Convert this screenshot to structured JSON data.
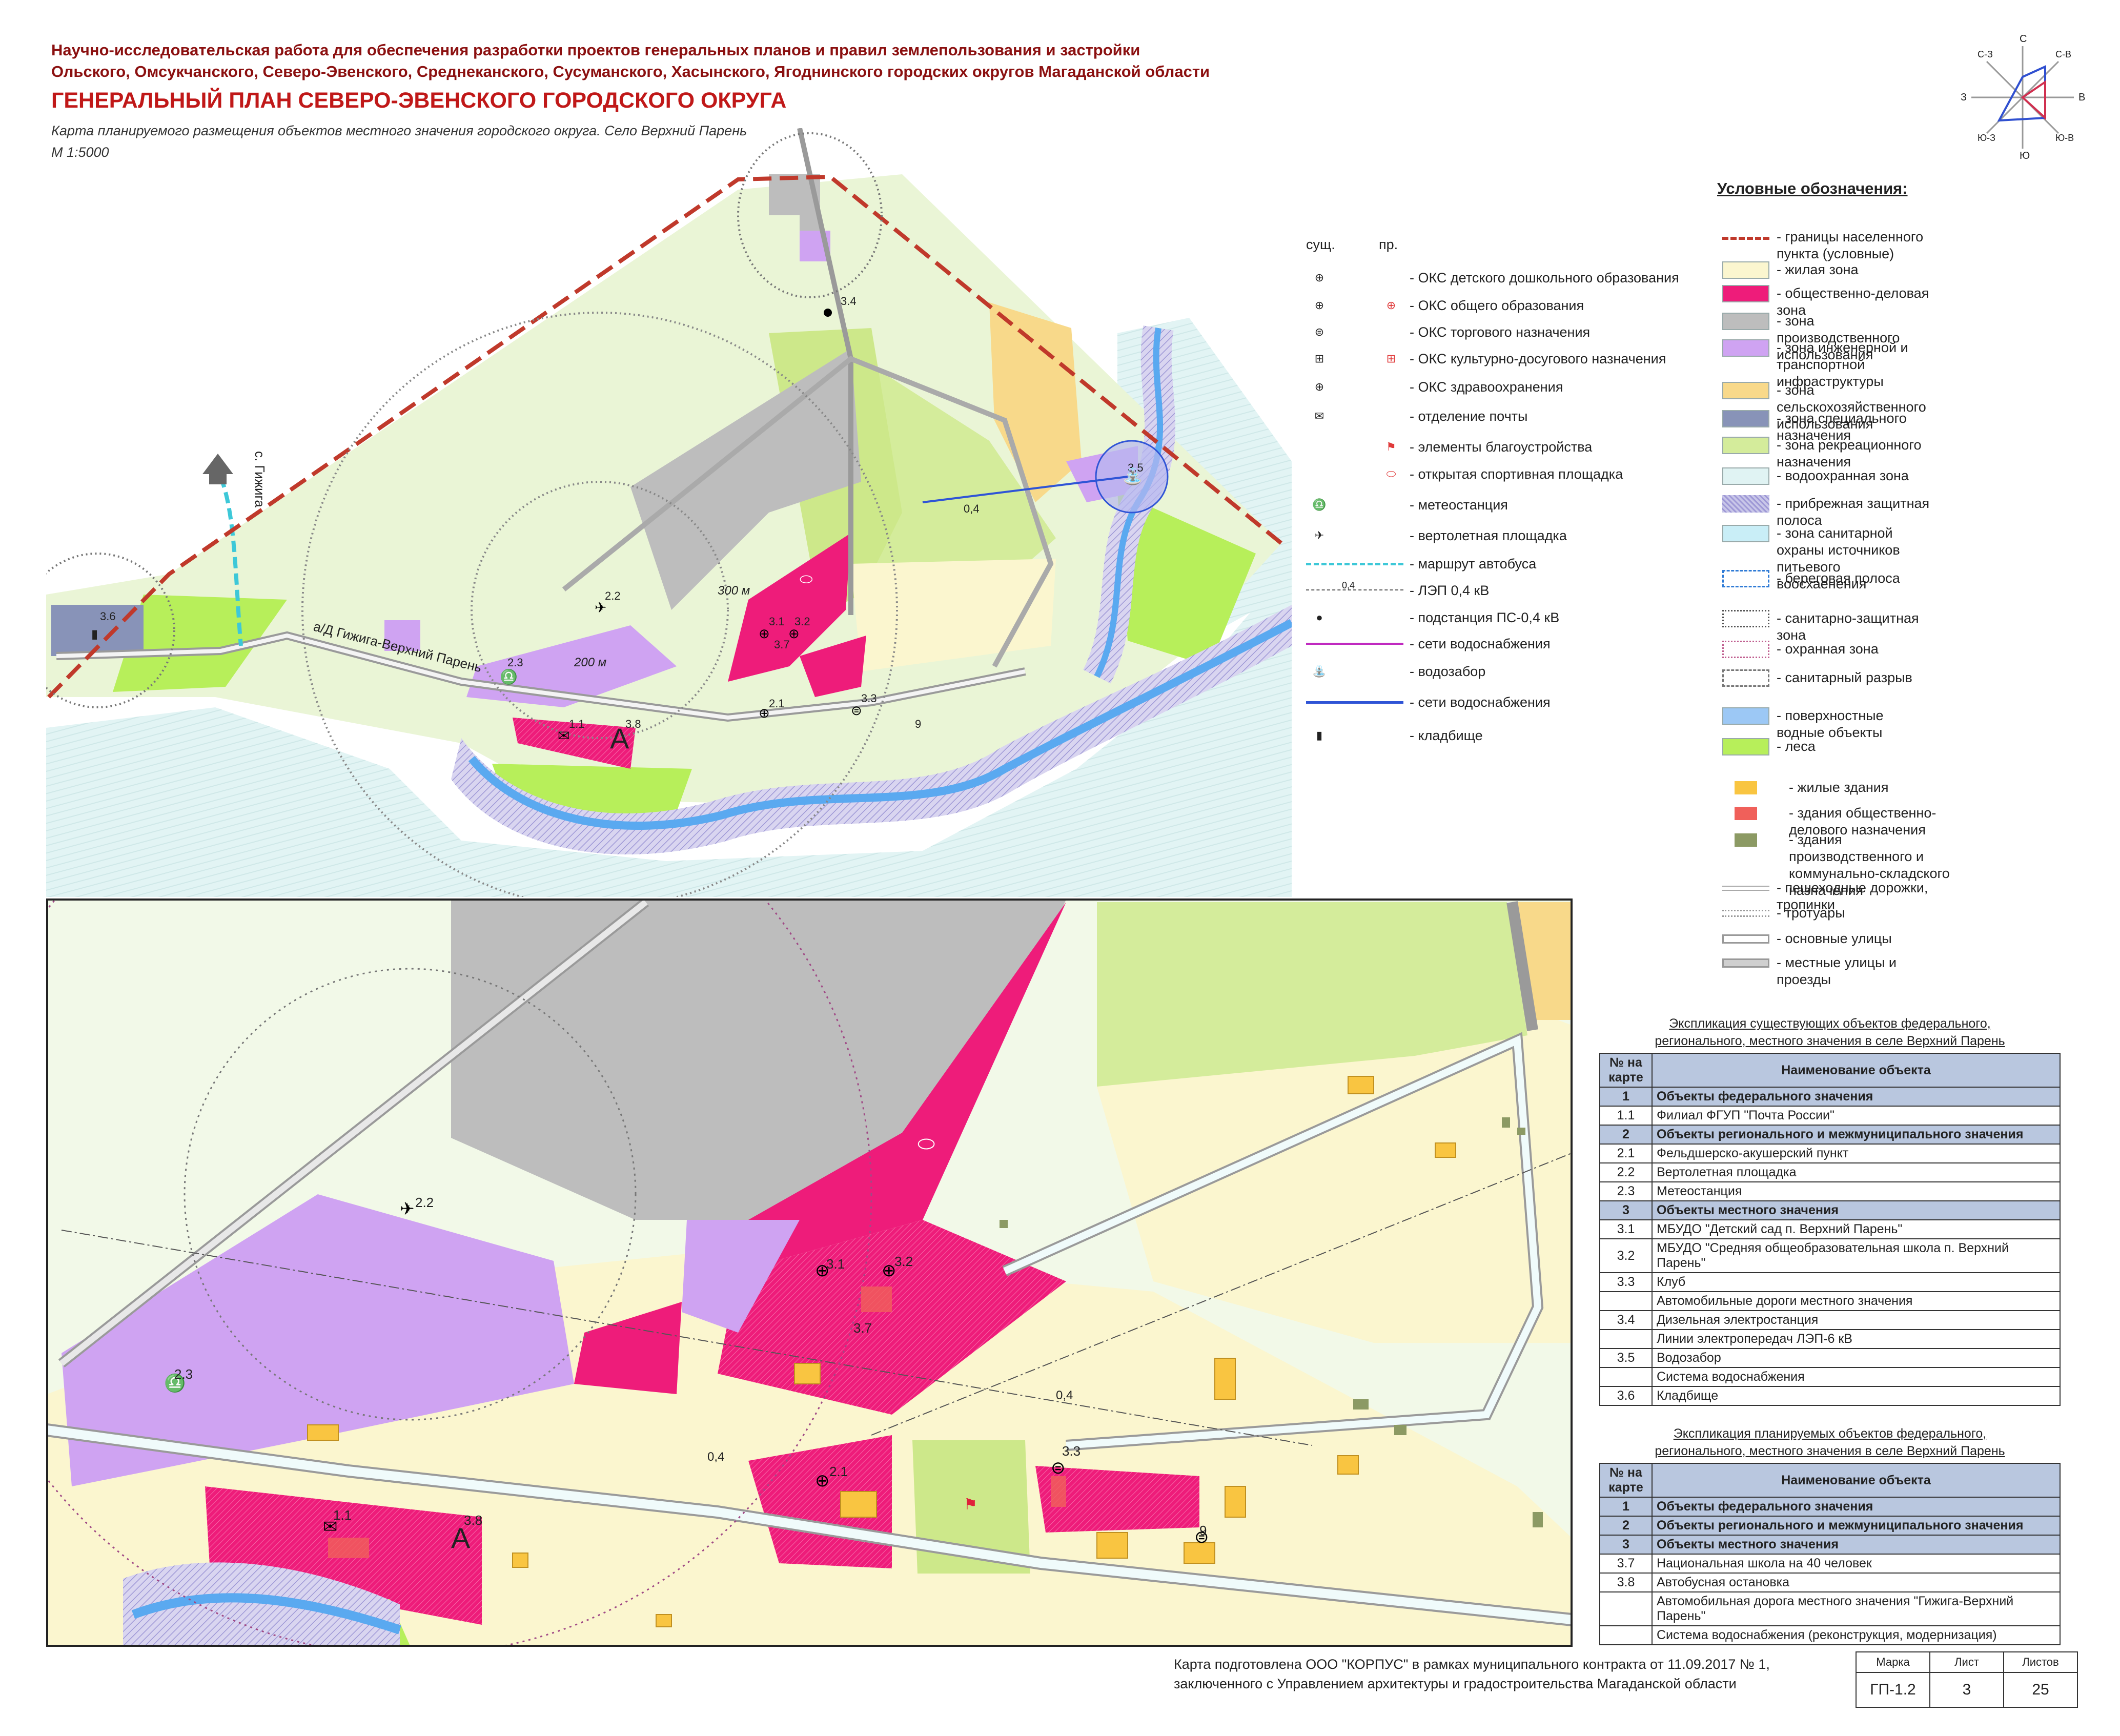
{
  "header": {
    "line1": "Научно-исследовательская работа для обеспечения разработки проектов генеральных планов и правил землепользования и застройки",
    "line2": "Ольского, Омсукчанского, Северо-Эвенского, Среднеканского, Сусуманского, Хасынского, Ягоднинского городских округов Магаданской области",
    "title": "ГЕНЕРАЛЬНЫЙ ПЛАН СЕВЕРО-ЭВЕНСКОГО ГОРОДСКОГО ОКРУГА",
    "subtitle": "Карта планируемого размещения объектов местного значения городского округа. Село Верхний Парень",
    "scale": "М 1:5000"
  },
  "compass": {
    "n": "С",
    "s": "Ю",
    "e": "В",
    "w": "З",
    "nw": "С-З",
    "ne": "С-В",
    "sw": "Ю-З",
    "se": "Ю-В"
  },
  "map_labels": {
    "village": "с. Гижига",
    "road": "а/Д Гижига-Верхний Парень",
    "dist300": "300 м",
    "dist200": "200 м",
    "line04": "0,4",
    "marker_a": "А",
    "obj": [
      "1.1",
      "2.1",
      "2.2",
      "2.3",
      "3.1",
      "3.2",
      "3.3",
      "3.4",
      "3.5",
      "3.6",
      "3.7",
      "3.8",
      "9"
    ]
  },
  "objects_legend": {
    "col_existing": "сущ.",
    "col_planned": "пр.",
    "items": [
      {
        "label": "- ОКС детского дошкольного образования",
        "icon": "kindergarten-icon",
        "existing": true,
        "planned": false
      },
      {
        "label": "- ОКС общего образования",
        "icon": "school-icon",
        "existing": true,
        "planned": true
      },
      {
        "label": "- ОКС торгового назначения",
        "icon": "shop-icon",
        "existing": true,
        "planned": false
      },
      {
        "label": "- ОКС культурно-досугового назначения",
        "icon": "culture-icon",
        "existing": true,
        "planned": true
      },
      {
        "label": "- ОКС здравоохранения",
        "icon": "health-icon",
        "existing": true,
        "planned": false
      },
      {
        "label": "- отделение почты",
        "icon": "post-icon",
        "existing": true,
        "planned": false
      },
      {
        "label": "- элементы благоустройства",
        "icon": "landscaping-icon",
        "existing": false,
        "planned": true
      },
      {
        "label": "- открытая спортивная площадка",
        "icon": "sports-ground-icon",
        "existing": false,
        "planned": true
      },
      {
        "label": "- метеостанция",
        "icon": "weather-station-icon",
        "existing": true,
        "planned": false
      },
      {
        "label": "- вертолетная площадка",
        "icon": "helipad-icon",
        "existing": true,
        "planned": false
      },
      {
        "label": "- маршрут автобуса",
        "icon": "bus-route-icon",
        "existing": false,
        "planned": true
      },
      {
        "label": "- ЛЭП 0,4 кВ",
        "icon": "power-line-icon",
        "existing": true,
        "planned": false
      },
      {
        "label": "- подстанция ПС-0,4 кВ",
        "icon": "substation-icon",
        "existing": true,
        "planned": false
      },
      {
        "label": "- сети водоснабжения",
        "icon": "water-network-icon",
        "existing": true,
        "planned": false
      },
      {
        "label": "- водозабор",
        "icon": "water-intake-icon",
        "existing": true,
        "planned": false
      },
      {
        "label": "- сети водоснабжения",
        "icon": "water-network-planned-icon",
        "existing": true,
        "planned": false
      },
      {
        "label": "- кладбище",
        "icon": "cemetery-icon",
        "existing": true,
        "planned": false
      }
    ],
    "power_line_tag": "0,4"
  },
  "legend": {
    "title": "Условные обозначения:",
    "items": [
      {
        "label": "- границы населенного пункта (условные)",
        "color": "#c0392b",
        "kind": "dash-line"
      },
      {
        "label": "- жилая зона",
        "color": "#fbf6cf",
        "kind": "fill"
      },
      {
        "label": "- общественно-деловая зона",
        "color": "#ee1c7a",
        "kind": "fill"
      },
      {
        "label": "- зона производственного использования",
        "color": "#bdbdbd",
        "kind": "fill"
      },
      {
        "label": "- зона инженерной и транспортной инфраструктуры",
        "color": "#cfa3f2",
        "kind": "fill"
      },
      {
        "label": "- зона сельскохозяйственного использования",
        "color": "#f8d98a",
        "kind": "fill"
      },
      {
        "label": "- зона специального назначения",
        "color": "#8893b8",
        "kind": "fill"
      },
      {
        "label": "- зона рекреационного назначения",
        "color": "#d4ec9b",
        "kind": "fill"
      },
      {
        "label": "- водоохранная зона",
        "color": "#e0f3f3",
        "kind": "fill"
      },
      {
        "label": "- прибрежная защитная полоса",
        "color": "#c8c6e8",
        "kind": "hatch"
      },
      {
        "label": "- зона санитарной охраны источников питьевого воосхаенения",
        "color": "#c9eef7",
        "kind": "fill"
      },
      {
        "label": "- береговая полоса",
        "color": "#2f7bd6",
        "kind": "dash-box"
      },
      {
        "label": "- санитарно-защитная зона",
        "color": "#555555",
        "kind": "dot-box"
      },
      {
        "label": "- охранная зона",
        "color": "#c06090",
        "kind": "dot-box"
      },
      {
        "label": "- санитарный разрыв",
        "color": "#777777",
        "kind": "dash-box"
      },
      {
        "label": "- поверхностные водные объекты",
        "color": "#9cc8f5",
        "kind": "fill"
      },
      {
        "label": "- леса",
        "color": "#b7ef5a",
        "kind": "fill"
      },
      {
        "label": "- жилые здания",
        "color": "#f9c541",
        "kind": "small"
      },
      {
        "label": "- здания общественно-делового назначения",
        "color": "#f0605a",
        "kind": "small"
      },
      {
        "label": "- здания производственного и коммунально-складского назначения",
        "color": "#8c9a64",
        "kind": "small"
      },
      {
        "label": "- пешеходные дорожки, тропинки",
        "color": "#bbbbbb",
        "kind": "line-thin"
      },
      {
        "label": "- тротуары",
        "color": "#cccccc",
        "kind": "line-dotted"
      },
      {
        "label": "- основные улицы",
        "color": "#ffffff",
        "kind": "line-main"
      },
      {
        "label": "- местные улицы и проезды",
        "color": "#cccccc",
        "kind": "line-local"
      }
    ]
  },
  "table_existing": {
    "caption1": "Экспликация существующих объектов федерального,",
    "caption2": "регионального, местного значения в селе Верхний Парень",
    "h_num": "№ на карте",
    "h_name": "Наименование объекта",
    "rows": [
      {
        "num": "1",
        "name": "Объекты федерального значения",
        "section": true
      },
      {
        "num": "1.1",
        "name": "Филиал ФГУП \"Почта России\"",
        "section": false
      },
      {
        "num": "2",
        "name": "Объекты регионального и межмуниципального значения",
        "section": true
      },
      {
        "num": "2.1",
        "name": "Фельдшерско-акушерский пункт",
        "section": false
      },
      {
        "num": "2.2",
        "name": "Вертолетная площадка",
        "section": false
      },
      {
        "num": "2.3",
        "name": "Метеостанция",
        "section": false
      },
      {
        "num": "3",
        "name": "Объекты местного значения",
        "section": true
      },
      {
        "num": "3.1",
        "name": "МБУДО \"Детский сад п. Верхний Парень\"",
        "section": false
      },
      {
        "num": "3.2",
        "name": "МБУДО \"Средняя общеобразовательная школа п. Верхний Парень\"",
        "section": false
      },
      {
        "num": "3.3",
        "name": "Клуб",
        "section": false
      },
      {
        "num": "",
        "name": "Автомобильные дороги местного значения",
        "section": false
      },
      {
        "num": "3.4",
        "name": "Дизельная электростанция",
        "section": false
      },
      {
        "num": "",
        "name": "Линии электропередач ЛЭП-6 кВ",
        "section": false
      },
      {
        "num": "3.5",
        "name": "Водозабор",
        "section": false
      },
      {
        "num": "",
        "name": "Система водоснабжения",
        "section": false
      },
      {
        "num": "3.6",
        "name": "Кладбище",
        "section": false
      }
    ]
  },
  "table_planned": {
    "caption1": "Экспликация планируемых объектов федерального,",
    "caption2": "регионального, местного значения в селе Верхний Парень",
    "h_num": "№ на карте",
    "h_name": "Наименование объекта",
    "rows": [
      {
        "num": "1",
        "name": "Объекты федерального значения",
        "section": true
      },
      {
        "num": "2",
        "name": "Объекты регионального и межмуниципального значения",
        "section": true
      },
      {
        "num": "3",
        "name": "Объекты местного значения",
        "section": true
      },
      {
        "num": "3.7",
        "name": "Национальная школа на 40 человек",
        "section": false
      },
      {
        "num": "3.8",
        "name": "Автобусная остановка",
        "section": false
      },
      {
        "num": "",
        "name": "Автомобильная дорога местного значения \"Гижига-Верхний Парень\"",
        "section": false
      },
      {
        "num": "",
        "name": "Система водоснабжения (реконструкция, модернизация)",
        "section": false
      }
    ]
  },
  "footer": {
    "credit": "Карта подготовлена ООО \"КОРПУС\" в рамках муниципального контракта от 11.09.2017 № 1, заключенного с Управлением архитектуры и градостроительства Магаданской области",
    "stamp_h_mark": "Марка",
    "stamp_h_sheet": "Лист",
    "stamp_h_sheets": "Листов",
    "stamp_mark": "ГП-1.2",
    "stamp_sheet": "3",
    "stamp_sheets": "25"
  }
}
